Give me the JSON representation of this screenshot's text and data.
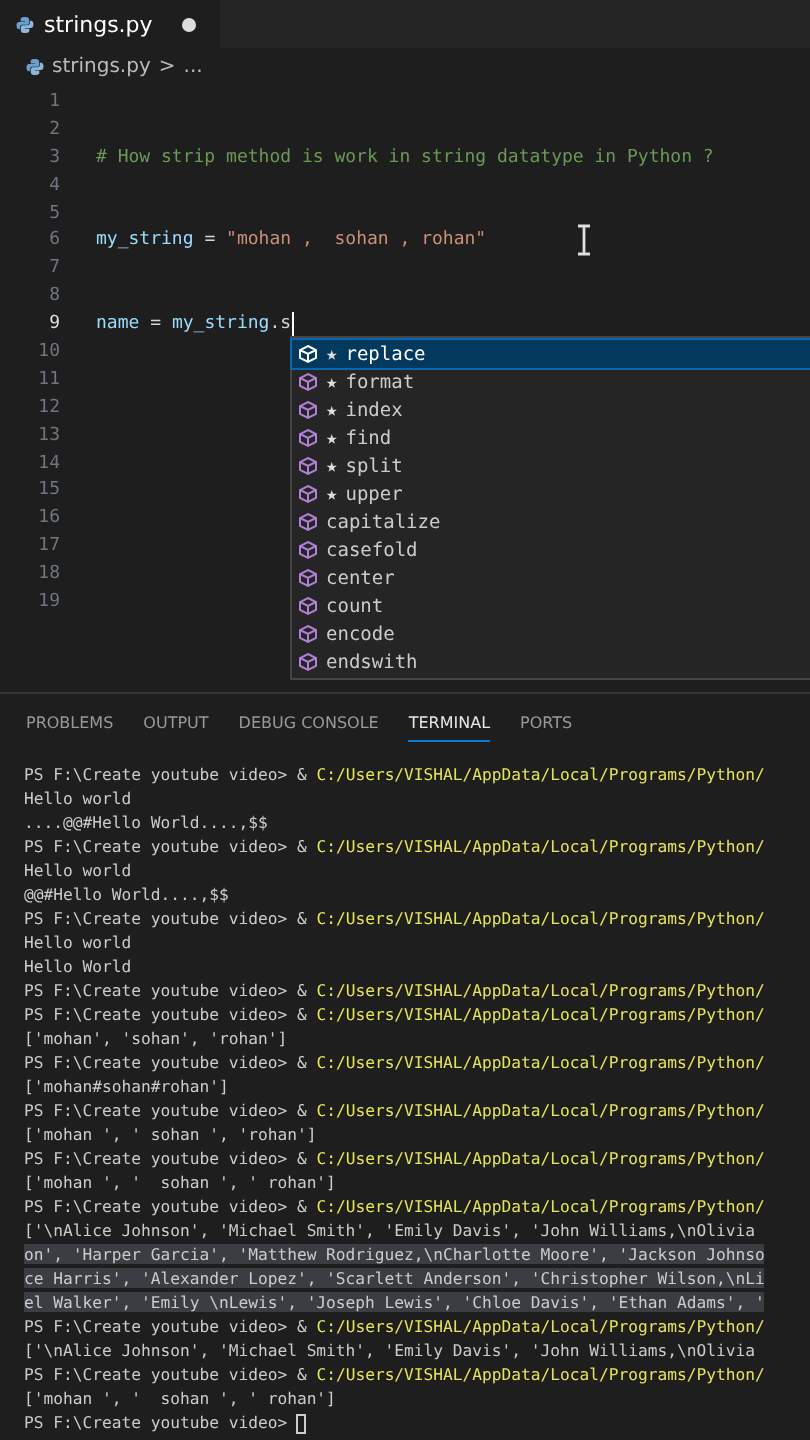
{
  "tab": {
    "label": "strings.py",
    "modified": true
  },
  "breadcrumb": {
    "file": "strings.py",
    "separator": ">",
    "rest": "..."
  },
  "code_lines": [
    {
      "number": "1",
      "active": false
    },
    {
      "number": "2",
      "active": false
    },
    {
      "number": "3",
      "active": false,
      "tokens": [
        {
          "text": "# How strip method is work in string datatype in Python ?",
          "kind": "comment"
        }
      ]
    },
    {
      "number": "4",
      "active": false
    },
    {
      "number": "5",
      "active": false
    },
    {
      "number": "6",
      "active": false,
      "tokens": [
        {
          "text": "my_string",
          "kind": "variable"
        },
        {
          "text": " = ",
          "kind": "operator"
        },
        {
          "text": "\"mohan ,  sohan , rohan\"",
          "kind": "string"
        }
      ]
    },
    {
      "number": "7",
      "active": false
    },
    {
      "number": "8",
      "active": false
    },
    {
      "number": "9",
      "active": true,
      "tokens": [
        {
          "text": "name",
          "kind": "variable"
        },
        {
          "text": " = ",
          "kind": "operator"
        },
        {
          "text": "my_string",
          "kind": "variable"
        },
        {
          "text": ".s",
          "kind": "operator"
        }
      ]
    },
    {
      "number": "10",
      "active": false
    },
    {
      "number": "11",
      "active": false
    },
    {
      "number": "12",
      "active": false
    },
    {
      "number": "13",
      "active": false
    },
    {
      "number": "14",
      "active": false
    },
    {
      "number": "15",
      "active": false
    },
    {
      "number": "16",
      "active": false
    },
    {
      "number": "17",
      "active": false
    },
    {
      "number": "18",
      "active": false
    },
    {
      "number": "19",
      "active": false
    }
  ],
  "suggestions": [
    {
      "star": "★",
      "label": "replace",
      "selected": true
    },
    {
      "star": "★",
      "label": "format",
      "selected": false
    },
    {
      "star": "★",
      "label": "index",
      "selected": false
    },
    {
      "star": "★",
      "label": "find",
      "selected": false
    },
    {
      "star": "★",
      "label": "split",
      "selected": false
    },
    {
      "star": "★",
      "label": "upper",
      "selected": false
    },
    {
      "label": "capitalize",
      "selected": false
    },
    {
      "label": "casefold",
      "selected": false
    },
    {
      "label": "center",
      "selected": false
    },
    {
      "label": "count",
      "selected": false
    },
    {
      "label": "encode",
      "selected": false
    },
    {
      "label": "endswith",
      "selected": false
    }
  ],
  "panel_tabs": [
    {
      "label": "PROBLEMS",
      "selected": false
    },
    {
      "label": "OUTPUT",
      "selected": false
    },
    {
      "label": "DEBUG CONSOLE",
      "selected": false
    },
    {
      "label": "TERMINAL",
      "selected": true
    },
    {
      "label": "PORTS",
      "selected": false
    }
  ],
  "terminal_lines": [
    {
      "kind": "command",
      "prompt": "PS F:\\Create youtube video> &",
      "path": "C:/Users/VISHAL/AppData/Local/Programs/Python/"
    },
    {
      "kind": "output",
      "text": "Hello world",
      "highlighted": false
    },
    {
      "kind": "output",
      "text": "....@@#Hello World....,$$",
      "highlighted": false
    },
    {
      "kind": "command",
      "prompt": "PS F:\\Create youtube video> &",
      "path": "C:/Users/VISHAL/AppData/Local/Programs/Python/"
    },
    {
      "kind": "output",
      "text": "Hello world",
      "highlighted": false
    },
    {
      "kind": "output",
      "text": "@@#Hello World....,$$",
      "highlighted": false
    },
    {
      "kind": "command",
      "prompt": "PS F:\\Create youtube video> &",
      "path": "C:/Users/VISHAL/AppData/Local/Programs/Python/"
    },
    {
      "kind": "output",
      "text": "Hello world",
      "highlighted": false
    },
    {
      "kind": "output",
      "text": "Hello World",
      "highlighted": false
    },
    {
      "kind": "command",
      "prompt": "PS F:\\Create youtube video> &",
      "path": "C:/Users/VISHAL/AppData/Local/Programs/Python/"
    },
    {
      "kind": "command",
      "prompt": "PS F:\\Create youtube video> &",
      "path": "C:/Users/VISHAL/AppData/Local/Programs/Python/"
    },
    {
      "kind": "output",
      "text": "['mohan', 'sohan', 'rohan']",
      "highlighted": false
    },
    {
      "kind": "command",
      "prompt": "PS F:\\Create youtube video> &",
      "path": "C:/Users/VISHAL/AppData/Local/Programs/Python/"
    },
    {
      "kind": "output",
      "text": "['mohan#sohan#rohan']",
      "highlighted": false
    },
    {
      "kind": "command",
      "prompt": "PS F:\\Create youtube video> &",
      "path": "C:/Users/VISHAL/AppData/Local/Programs/Python/"
    },
    {
      "kind": "output",
      "text": "['mohan ', ' sohan ', 'rohan']",
      "highlighted": false
    },
    {
      "kind": "command",
      "prompt": "PS F:\\Create youtube video> &",
      "path": "C:/Users/VISHAL/AppData/Local/Programs/Python/"
    },
    {
      "kind": "output",
      "text": "['mohan ', '  sohan ', ' rohan']",
      "highlighted": false
    },
    {
      "kind": "command",
      "prompt": "PS F:\\Create youtube video> &",
      "path": "C:/Users/VISHAL/AppData/Local/Programs/Python/"
    },
    {
      "kind": "output",
      "text": "['\\nAlice Johnson', 'Michael Smith', 'Emily Davis', 'John Williams,\\nOlivia",
      "highlighted": false
    },
    {
      "kind": "output",
      "text": "on', 'Harper Garcia', 'Matthew Rodriguez,\\nCharlotte Moore', 'Jackson Johnso",
      "highlighted": true
    },
    {
      "kind": "output",
      "text": "ce Harris', 'Alexander Lopez', 'Scarlett Anderson', 'Christopher Wilson,\\nLi",
      "highlighted": true
    },
    {
      "kind": "output",
      "text": "el Walker', 'Emily \\nLewis', 'Joseph Lewis', 'Chloe Davis', 'Ethan Adams', '",
      "highlighted": true
    },
    {
      "kind": "command",
      "prompt": "PS F:\\Create youtube video> &",
      "path": "C:/Users/VISHAL/AppData/Local/Programs/Python/"
    },
    {
      "kind": "output",
      "text": "['\\nAlice Johnson', 'Michael Smith', 'Emily Davis', 'John Williams,\\nOlivia",
      "highlighted": false
    },
    {
      "kind": "command",
      "prompt": "PS F:\\Create youtube video> &",
      "path": "C:/Users/VISHAL/AppData/Local/Programs/Python/"
    },
    {
      "kind": "output",
      "text": "['mohan ', '  sohan ', ' rohan']",
      "highlighted": false
    },
    {
      "kind": "prompt",
      "prompt": "PS F:\\Create youtube video>"
    }
  ]
}
